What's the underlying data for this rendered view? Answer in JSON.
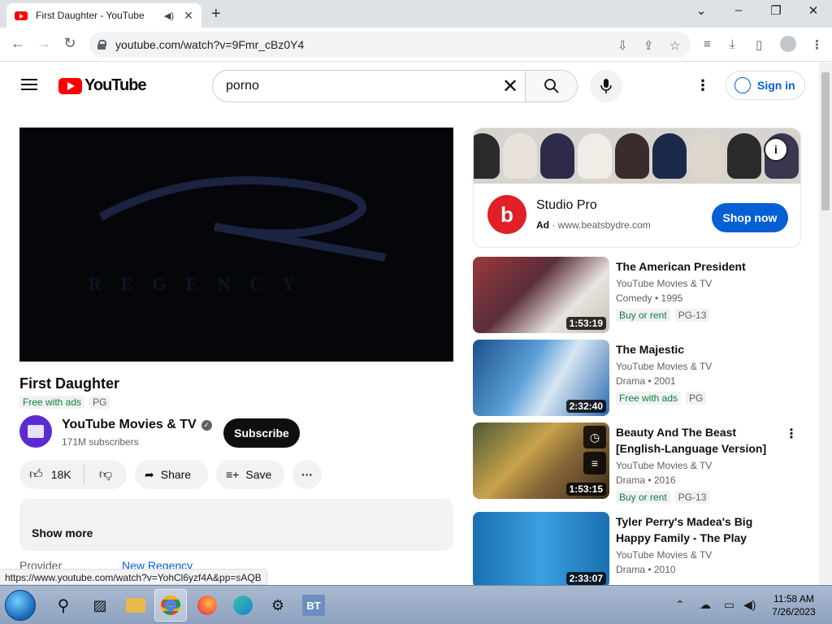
{
  "browser": {
    "tab_title": "First Daughter - YouTube",
    "url": "youtube.com/watch?v=9Fmr_cBz0Y4",
    "status_url": "https://www.youtube.com/watch?v=YohCl6yzf4A&pp=sAQB"
  },
  "header": {
    "logo_text": "YouTube",
    "search_value": "porno",
    "signin_label": "Sign in"
  },
  "player": {
    "overlay_text": "REGENCY"
  },
  "video": {
    "title": "First Daughter",
    "free_badge": "Free with ads",
    "rating": "PG",
    "channel_name": "YouTube Movies & TV",
    "subscribers": "171M subscribers",
    "subscribe_label": "Subscribe",
    "likes": "18K",
    "share_label": "Share",
    "save_label": "Save",
    "show_more": "Show more",
    "provider_label": "Provider",
    "provider_value": "New Regency"
  },
  "ad": {
    "title": "Studio Pro",
    "ad_label": "Ad",
    "domain": "www.beatsbydre.com",
    "cta": "Shop now"
  },
  "recommendations": [
    {
      "title": "The American President",
      "channel": "YouTube Movies & TV",
      "meta": "Comedy • 1995",
      "badge": "Buy or rent",
      "rating": "PG-13",
      "duration": "1:53:19"
    },
    {
      "title": "The Majestic",
      "channel": "YouTube Movies & TV",
      "meta": "Drama • 2001",
      "badge": "Free with ads",
      "rating": "PG",
      "duration": "2:32:40"
    },
    {
      "title": "Beauty And The Beast [English-Language Version]",
      "channel": "YouTube Movies & TV",
      "meta": "Drama • 2016",
      "badge": "Buy or rent",
      "rating": "PG-13",
      "duration": "1:53:15"
    },
    {
      "title": "Tyler Perry's Madea's Big Happy Family - The Play",
      "channel": "YouTube Movies & TV",
      "meta": "Drama • 2010",
      "badge": "",
      "rating": "",
      "duration": "2:33:07"
    }
  ],
  "taskbar": {
    "time": "11:58 AM",
    "date": "7/26/2023"
  },
  "colors": {
    "yt_red": "#ff0000",
    "link_blue": "#065fd4",
    "free_green": "#0b8043"
  }
}
